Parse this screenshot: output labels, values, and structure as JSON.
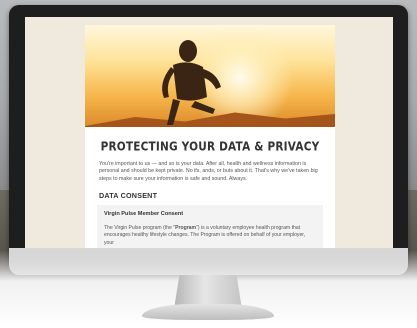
{
  "page": {
    "title": "PROTECTING YOUR DATA & PRIVACY",
    "intro": "You're important to us — and so is your data. After all, health and wellness information is personal and should be kept private. No ifs, ands, or buts about it. That's why we've taken big steps to make sure your information is safe and sound. Always.",
    "section_heading": "DATA CONSENT",
    "consent": {
      "title": "Virgin Pulse Member Consent",
      "body_prefix": "The Virgin Pulse program (the \"",
      "body_bold": "Program",
      "body_suffix": "\") is a voluntary employee health program that encourages healthy lifestyle changes. The Program is offered on behalf of your employer, your"
    }
  },
  "colors": {
    "screen_background": "#efe9de",
    "hero_sunset": "#f6b64a",
    "heading_text": "#333333",
    "body_text": "#555555"
  },
  "hero_image": "runner-silhouette-at-sunset"
}
